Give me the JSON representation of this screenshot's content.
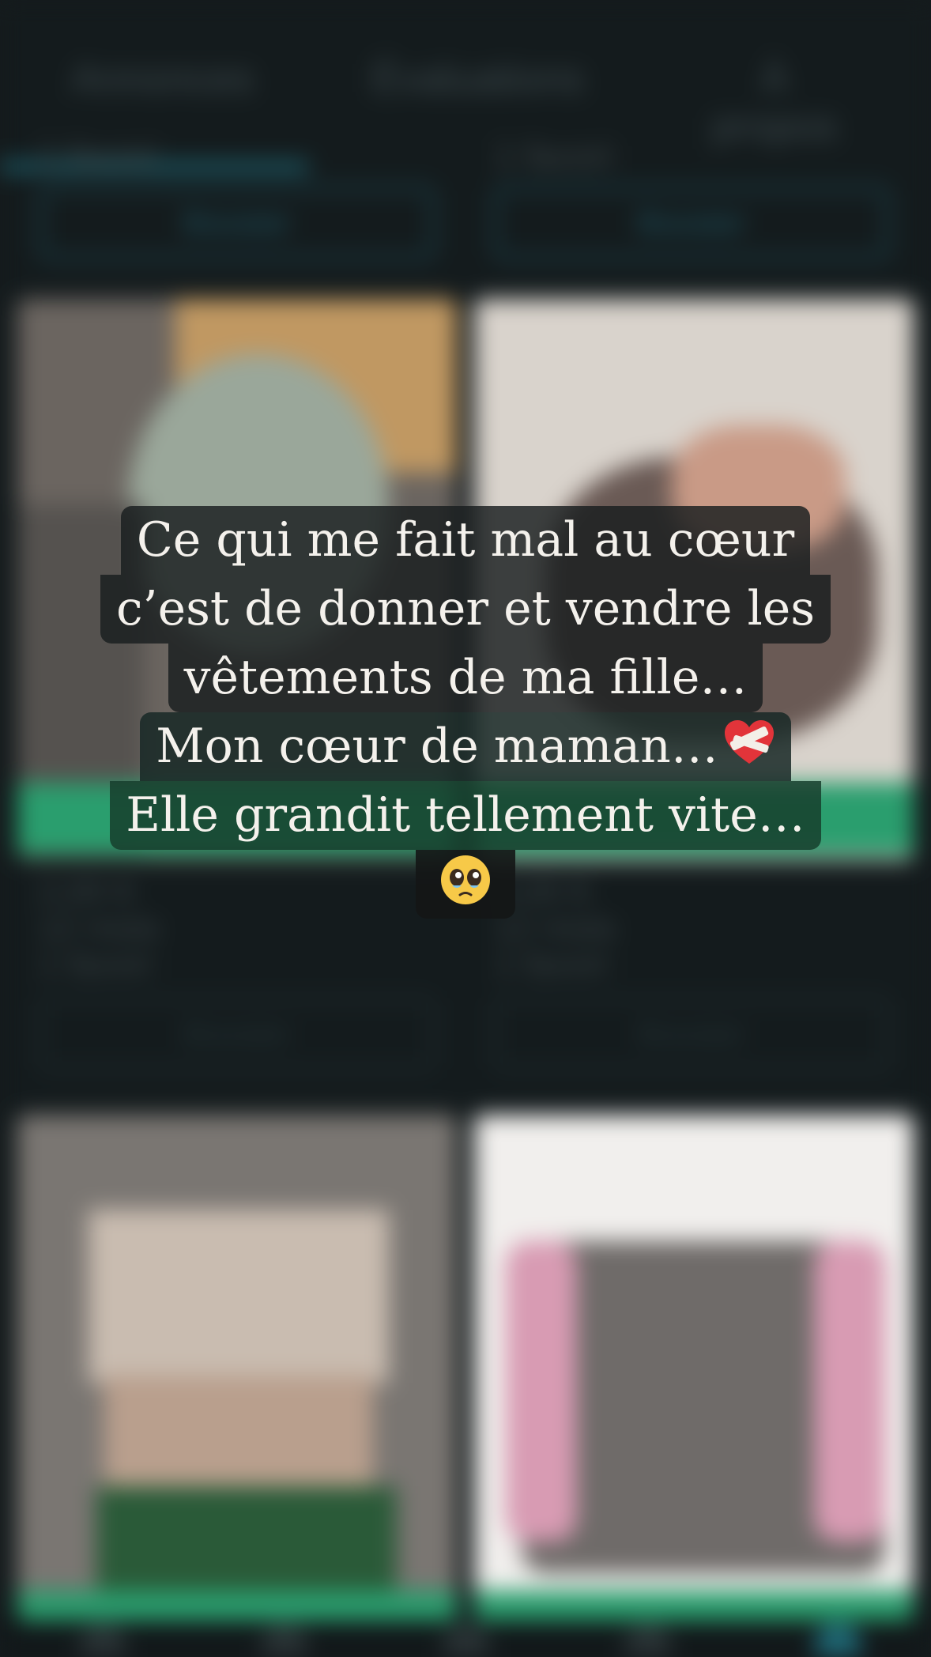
{
  "tabs": [
    "Annonces",
    "Évaluations",
    "À propos"
  ],
  "cards_top": [
    {
      "label": "1 favori",
      "button": "Booster"
    },
    {
      "label": "1 favori",
      "button": "Booster"
    }
  ],
  "cards_mid": [
    {
      "price": "2,00 €",
      "size": "12 mois",
      "status": "1 favori",
      "button": "Booster"
    },
    {
      "price": "3,00 €",
      "size": "12 mois",
      "status": "1 favori",
      "button": "Booster"
    }
  ],
  "story": {
    "line1": "Ce qui me fait mal au cœur",
    "line2": "c’est de donner et vendre les",
    "line3": "vêtements de ma fille…",
    "line4": "Mon cœur de maman…",
    "line5": "Elle grandit tellement vite…",
    "heart_emoji": "mending-heart-icon",
    "face_emoji": "pleading-face-icon"
  },
  "colors": {
    "background": "#151b1d",
    "accent_green": "#2a9e6e",
    "accent_teal": "#1d5866"
  }
}
